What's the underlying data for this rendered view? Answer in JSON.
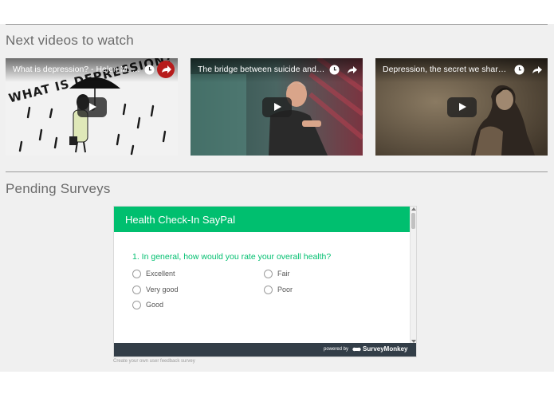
{
  "sections": {
    "videos_heading": "Next videos to watch",
    "surveys_heading": "Pending Surveys"
  },
  "videos": [
    {
      "title": "What is depression? - Helen M. Farr...",
      "icons": [
        "clock-icon",
        "share-icon"
      ]
    },
    {
      "title": "The bridge between suicide and life...",
      "icons": [
        "clock-icon",
        "share-icon"
      ]
    },
    {
      "title": "Depression, the secret we share | A...",
      "icons": [
        "clock-icon",
        "share-icon"
      ]
    }
  ],
  "survey": {
    "title": "Health Check-In SayPal",
    "question": "1. In general, how would you rate your overall health?",
    "options": [
      "Excellent",
      "Very good",
      "Good",
      "Fair",
      "Poor"
    ],
    "powered_by": "powered by",
    "brand": "SurveyMonkey",
    "create_link": "Create your own user feedback survey"
  },
  "thumbnail_text": "WHAT IS DEPRESSION?",
  "colors": {
    "survey_accent": "#00bf6f",
    "survey_footer": "#333e48",
    "page_band": "#f0f0f0",
    "share_badge": "#b71c1c"
  }
}
